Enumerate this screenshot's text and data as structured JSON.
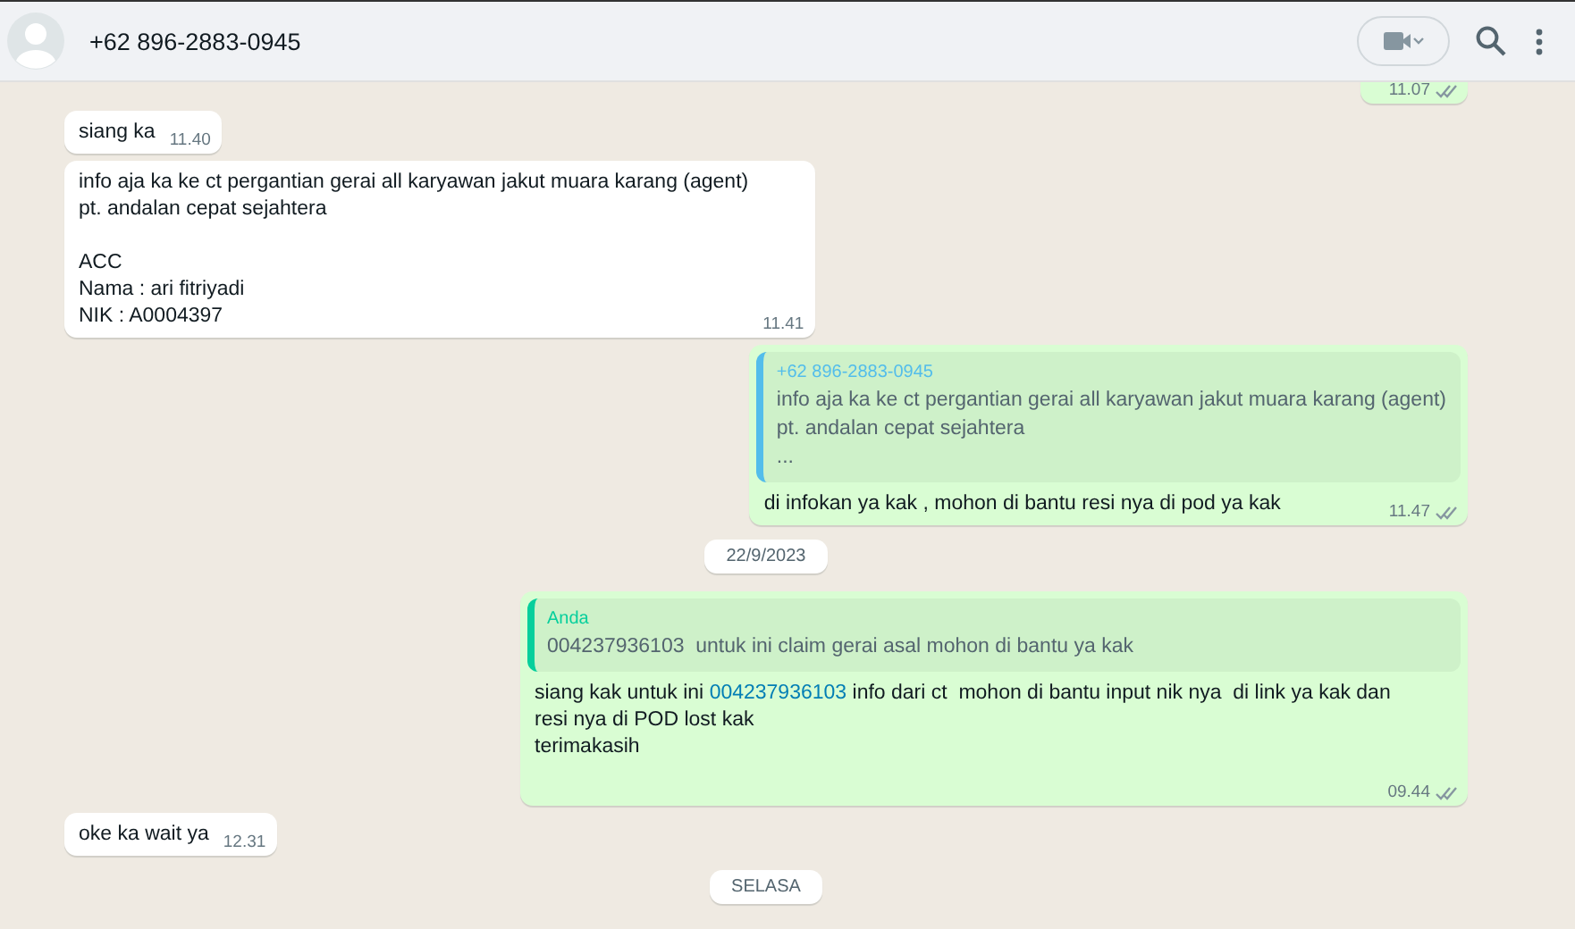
{
  "header": {
    "title": "+62 896-2883-0945"
  },
  "messages": [
    {
      "kind": "outgoing",
      "time": "11.07",
      "delivered": true
    },
    {
      "kind": "incoming",
      "paragraphs": [
        [
          [
            {
              "kind": "plain",
              "text": "siang ka"
            }
          ]
        ]
      ],
      "time": "11.40"
    },
    {
      "kind": "incoming",
      "paragraphs": [
        [
          [
            {
              "kind": "plain",
              "text": "info aja ka ke ct pergantian gerai all karyawan jakut muara karang (agent)"
            }
          ],
          [
            {
              "kind": "plain",
              "text": "pt. andalan cepat sejahtera"
            }
          ]
        ],
        [
          [
            {
              "kind": "plain",
              "text": "ACC"
            }
          ],
          [
            {
              "kind": "plain",
              "text": "Nama : ari fitriyadi"
            }
          ],
          [
            {
              "kind": "plain",
              "text": "NIK : A0004397"
            }
          ]
        ]
      ],
      "time": "11.41"
    },
    {
      "kind": "outgoing",
      "quote": {
        "author": "+62 896-2883-0945",
        "color": "#53bdeb",
        "lines": [
          "info aja ka ke ct pergantian gerai all karyawan jakut muara karang (agent)",
          "pt. andalan cepat sejahtera",
          "..."
        ]
      },
      "paragraphs": [
        [
          [
            {
              "kind": "plain",
              "text": "di infokan ya kak , mohon di bantu resi nya di pod ya kak"
            }
          ]
        ]
      ],
      "time": "11.47",
      "delivered": true
    },
    {
      "kind": "date",
      "text": "22/9/2023"
    },
    {
      "kind": "outgoing",
      "quote": {
        "author": "Anda",
        "color": "#06cf9c",
        "lines": [
          "004237936103  untuk ini claim gerai asal mohon di bantu ya kak"
        ]
      },
      "paragraphs": [
        [
          [
            {
              "kind": "plain",
              "text": "siang kak untuk ini "
            },
            {
              "kind": "link",
              "text": "004237936103"
            },
            {
              "kind": "plain",
              "text": " info dari ct  mohon di bantu input nik nya  di link ya kak dan"
            }
          ],
          [
            {
              "kind": "plain",
              "text": "resi nya di POD lost kak"
            }
          ],
          [
            {
              "kind": "plain",
              "text": "terimakasih"
            }
          ]
        ]
      ],
      "time": "09.44",
      "delivered": true
    },
    {
      "kind": "incoming",
      "paragraphs": [
        [
          [
            {
              "kind": "plain",
              "text": "oke ka wait ya"
            }
          ]
        ]
      ],
      "time": "12.31"
    },
    {
      "kind": "date",
      "text": "SELASA"
    }
  ]
}
